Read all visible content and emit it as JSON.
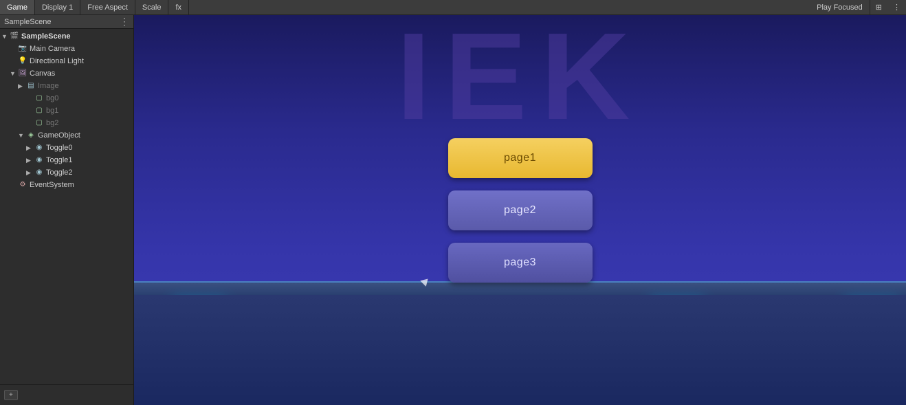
{
  "toolbar": {
    "tabs": [
      "Game",
      "Display 1",
      "Free Aspect",
      "Scale",
      "fx",
      "Play Focused"
    ],
    "active_tab": "Game",
    "maximize_icon": "⊞"
  },
  "sidebar": {
    "title": "SampleScene",
    "more_icon": "⋮",
    "hierarchy": [
      {
        "id": "sample-scene",
        "label": "SampleScene",
        "depth": 0,
        "icon": "scene",
        "expanded": true
      },
      {
        "id": "main-camera",
        "label": "Main Camera",
        "depth": 1,
        "icon": "camera",
        "expanded": false
      },
      {
        "id": "directional-light",
        "label": "Directional Light",
        "depth": 1,
        "icon": "light",
        "expanded": false
      },
      {
        "id": "canvas",
        "label": "Canvas",
        "depth": 1,
        "icon": "canvas",
        "expanded": true
      },
      {
        "id": "image",
        "label": "Image",
        "depth": 2,
        "icon": "image",
        "expanded": false,
        "dimmed": true
      },
      {
        "id": "bg0",
        "label": "bg0",
        "depth": 3,
        "icon": "obj",
        "expanded": false,
        "dimmed": true
      },
      {
        "id": "bg1",
        "label": "bg1",
        "depth": 3,
        "icon": "obj",
        "expanded": false,
        "dimmed": true
      },
      {
        "id": "bg2",
        "label": "bg2",
        "depth": 3,
        "icon": "obj",
        "expanded": false,
        "dimmed": true
      },
      {
        "id": "gameobject",
        "label": "GameObject",
        "depth": 2,
        "icon": "obj",
        "expanded": true
      },
      {
        "id": "toggle0",
        "label": "Toggle0",
        "depth": 3,
        "icon": "toggle",
        "expanded": false
      },
      {
        "id": "toggle1",
        "label": "Toggle1",
        "depth": 3,
        "icon": "toggle",
        "expanded": false
      },
      {
        "id": "toggle2",
        "label": "Toggle2",
        "depth": 3,
        "icon": "toggle",
        "expanded": false
      },
      {
        "id": "eventsystem",
        "label": "EventSystem",
        "depth": 1,
        "icon": "eventsys",
        "expanded": false
      }
    ]
  },
  "game_view": {
    "bg_letters": "IEK",
    "page_buttons": [
      {
        "id": "page1",
        "label": "page1",
        "style": "yellow"
      },
      {
        "id": "page2",
        "label": "page2",
        "style": "purple"
      },
      {
        "id": "page3",
        "label": "page3",
        "style": "purple-dark"
      }
    ]
  },
  "colors": {
    "bg_dark": "#2d2d2d",
    "toolbar_bg": "#3c3c3c",
    "accent_cyan": "#00ffff",
    "btn_yellow": "#f5d060",
    "btn_purple": "#7070c8"
  }
}
